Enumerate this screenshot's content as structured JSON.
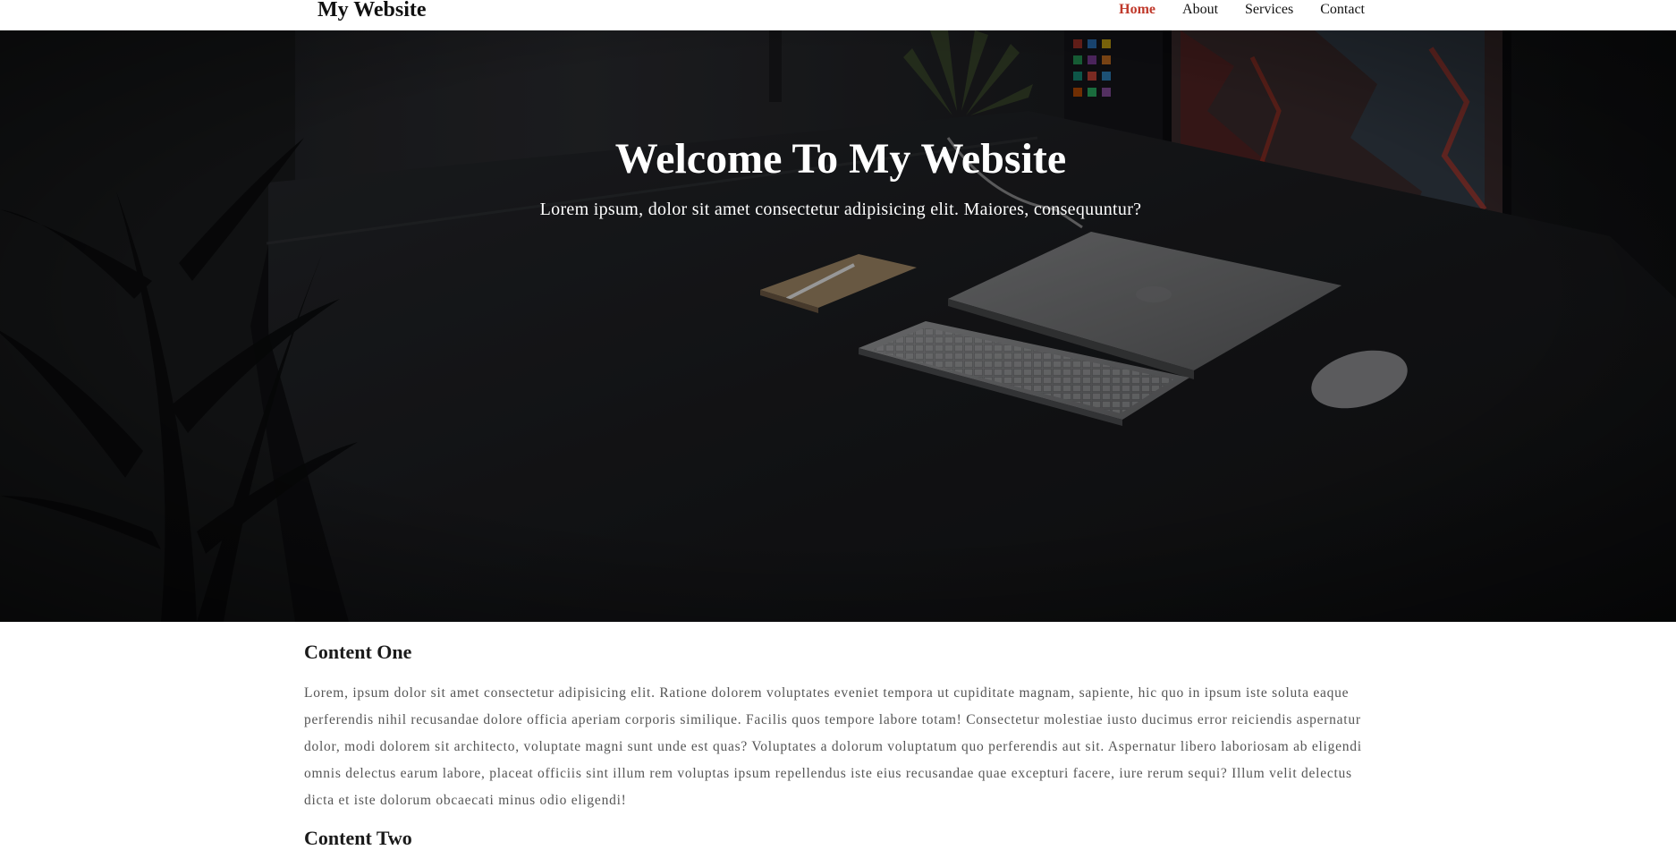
{
  "nav": {
    "logo": "My Website",
    "links": [
      "Home",
      "About",
      "Services",
      "Contact"
    ],
    "active": "Home"
  },
  "hero": {
    "title": "Welcome To My Website",
    "subtitle": "Lorem ipsum, dolor sit amet consectetur adipisicing elit. Maiores, consequuntur?"
  },
  "content": {
    "sections": [
      {
        "heading": "Content One",
        "text": "Lorem, ipsum dolor sit amet consectetur adipisicing elit. Ratione dolorem voluptates eveniet tempora ut cupiditate magnam, sapiente, hic quo in ipsum iste soluta eaque perferendis nihil recusandae dolore officia aperiam corporis similique. Facilis quos tempore labore totam! Consectetur molestiae iusto ducimus error reiciendis aspernatur dolor, modi dolorem sit architecto, voluptate magni sunt unde est quas? Voluptates a dolorum voluptatum quo perferendis aut sit. Aspernatur libero laboriosam ab eligendi omnis delectus earum labore, placeat officiis sint illum rem voluptas ipsum repellendus iste eius recusandae quae excepturi facere, iure rerum sequi? Illum velit delectus dicta et iste dolorum obcaecati minus odio eligendi!"
      },
      {
        "heading": "Content Two"
      }
    ]
  },
  "colors": {
    "accent": "#c0392b",
    "hero_overlay": "#0d0e10",
    "body_text": "#555555"
  }
}
